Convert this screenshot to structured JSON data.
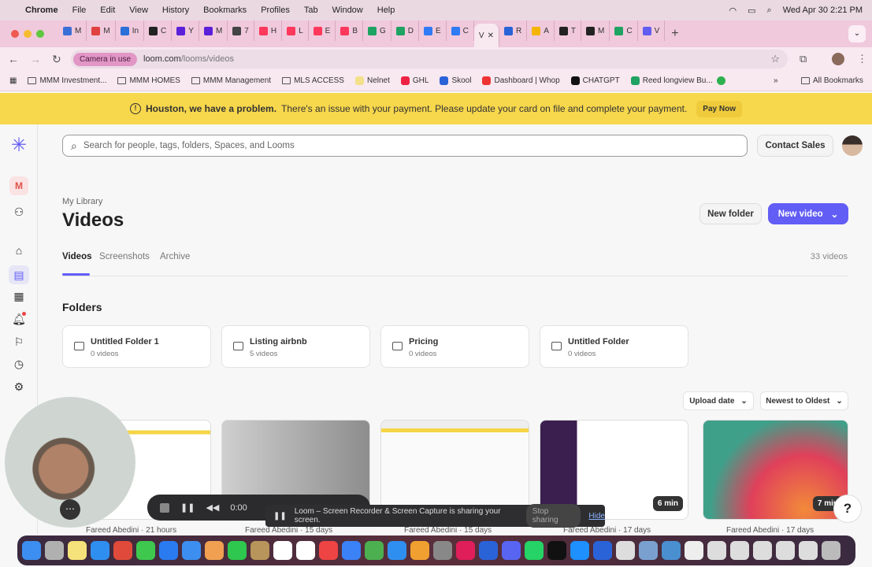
{
  "menubar": {
    "app": "Chrome",
    "items": [
      "File",
      "Edit",
      "View",
      "History",
      "Bookmarks",
      "Profiles",
      "Tab",
      "Window",
      "Help"
    ],
    "datetime": "Wed Apr 30  2:21 PM"
  },
  "tabs": [
    {
      "l": "M",
      "c": "#3b6fd8"
    },
    {
      "l": "M",
      "c": "#e04040"
    },
    {
      "l": "In",
      "c": "#2b6fd8"
    },
    {
      "l": "C",
      "c": "#222"
    },
    {
      "l": "Y",
      "c": "#5a20d8"
    },
    {
      "l": "M",
      "c": "#5a20d8"
    },
    {
      "l": "7",
      "c": "#444"
    },
    {
      "l": "H",
      "c": "#ff385c"
    },
    {
      "l": "L",
      "c": "#ff385c"
    },
    {
      "l": "E",
      "c": "#ff385c"
    },
    {
      "l": "B",
      "c": "#ff385c"
    },
    {
      "l": "G",
      "c": "#1ea362"
    },
    {
      "l": "D",
      "c": "#1ea362"
    },
    {
      "l": "E",
      "c": "#2f7bf5"
    },
    {
      "l": "C",
      "c": "#2f7bf5"
    },
    {
      "l": "V",
      "c": "#625df5",
      "active": true
    },
    {
      "l": "R",
      "c": "#2a63d8"
    },
    {
      "l": "A",
      "c": "#f4b400"
    },
    {
      "l": "T",
      "c": "#222"
    },
    {
      "l": "M",
      "c": "#222"
    },
    {
      "l": "C",
      "c": "#1ea362"
    },
    {
      "l": "V",
      "c": "#625df5"
    }
  ],
  "toolbar": {
    "camera_badge": "Camera in use",
    "url_host": "loom.com",
    "url_path": "/looms/videos"
  },
  "bookmarks": [
    {
      "label": "MMM Investment...",
      "icon": "folder"
    },
    {
      "label": "MMM HOMES",
      "icon": "folder"
    },
    {
      "label": "MMM Management",
      "icon": "folder"
    },
    {
      "label": "MLS ACCESS",
      "icon": "folder"
    },
    {
      "label": "Nelnet",
      "icon": "nelnet"
    },
    {
      "label": "GHL",
      "icon": "ghl"
    },
    {
      "label": "Skool",
      "icon": "skool"
    },
    {
      "label": "Dashboard | Whop",
      "icon": "whop"
    },
    {
      "label": "CHATGPT",
      "icon": "chatgpt"
    },
    {
      "label": "Reed longview Bu...",
      "icon": "sheets"
    }
  ],
  "all_bookmarks": "All Bookmarks",
  "banner": {
    "bold": "Houston, we have a problem.",
    "text": "There's an issue with your payment. Please update your card on file and complete your payment.",
    "action": "Pay Now",
    "color": "#f7d74c"
  },
  "search": {
    "placeholder": "Search for people, tags, folders, Spaces, and Looms"
  },
  "header": {
    "contact_sales": "Contact Sales",
    "breadcrumb": "My Library",
    "title": "Videos",
    "new_folder": "New folder",
    "new_video": "New video",
    "accent": "#625df5"
  },
  "workspace_initial": "M",
  "page_tabs": [
    "Videos",
    "Screenshots",
    "Archive"
  ],
  "video_count": "33 videos",
  "folders_heading": "Folders",
  "folders": [
    {
      "name": "Untitled Folder 1",
      "count": "0 videos"
    },
    {
      "name": "Listing airbnb",
      "count": "5 videos"
    },
    {
      "name": "Pricing",
      "count": "0 videos"
    },
    {
      "name": "Untitled Folder",
      "count": "0 videos"
    }
  ],
  "sort": {
    "field": "Upload date",
    "order": "Newest to Oldest"
  },
  "videos": [
    {
      "owner": "Fareed Abedini · 21 hours",
      "duration": ""
    },
    {
      "owner": "Fareed Abedini · 15 days",
      "duration": ""
    },
    {
      "owner": "Fareed Abedini · 15 days",
      "duration": ""
    },
    {
      "owner": "Fareed Abedini · 17 days",
      "duration": "6 min"
    },
    {
      "owner": "Fareed Abedini · 17 days",
      "duration": "7 min"
    }
  ],
  "recorder": {
    "time": "0:00"
  },
  "share_bar": {
    "text": "Loom – Screen Recorder & Screen Capture is sharing your screen.",
    "stop": "Stop sharing",
    "hide": "Hide"
  },
  "help": "?"
}
